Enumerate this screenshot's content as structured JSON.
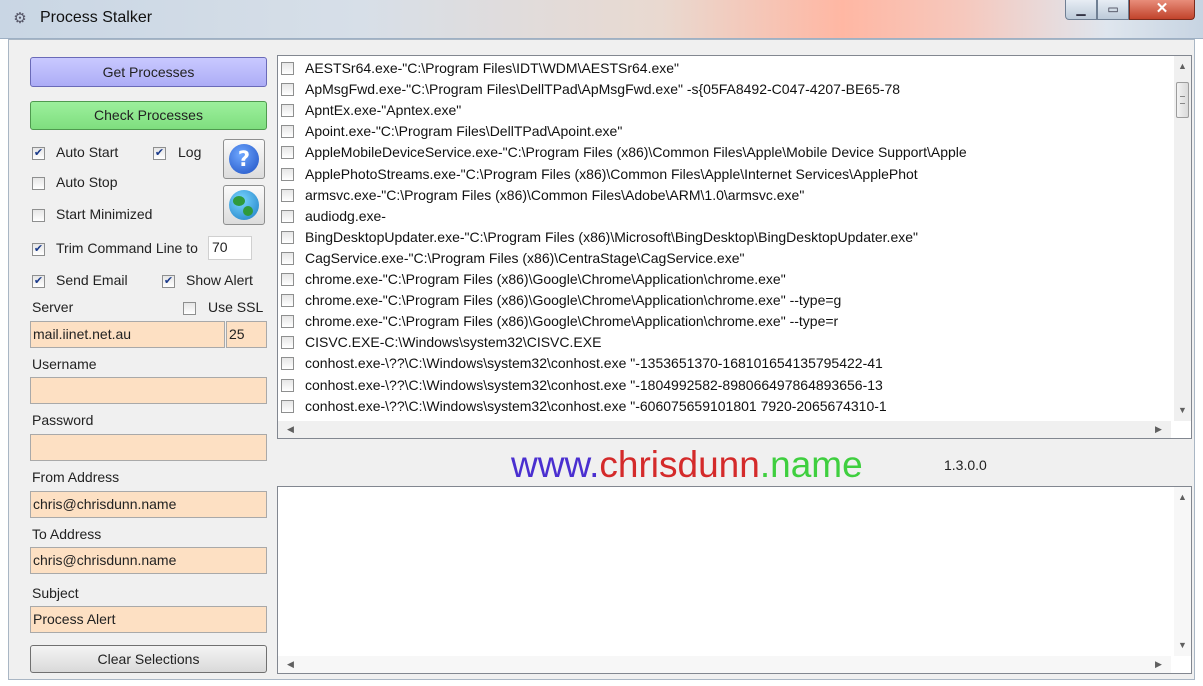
{
  "window": {
    "title": "Process Stalker",
    "app_icon": "gear-icon",
    "controls": {
      "minimize": "▁",
      "maximize": "▭",
      "close": "✕"
    }
  },
  "left_panel": {
    "get_processes": "Get Processes",
    "check_processes": "Check Processes",
    "auto_start": {
      "label": "Auto Start",
      "checked": true
    },
    "log": {
      "label": "Log",
      "checked": true
    },
    "auto_stop": {
      "label": "Auto Stop",
      "checked": false
    },
    "start_minimized": {
      "label": "Start Minimized",
      "checked": false
    },
    "trim_command_line": {
      "label": "Trim Command Line to",
      "checked": true,
      "value": "70"
    },
    "send_email": {
      "label": "Send Email",
      "checked": true
    },
    "show_alert": {
      "label": "Show Alert",
      "checked": true
    },
    "server_label": "Server",
    "use_ssl": {
      "label": "Use SSL",
      "checked": false
    },
    "server_value": "mail.iinet.net.au",
    "port_value": "25",
    "username_label": "Username",
    "username_value": "",
    "password_label": "Password",
    "password_value": "",
    "from_label": "From Address",
    "from_value": "chris@chrisdunn.name",
    "to_label": "To Address",
    "to_value": "chris@chrisdunn.name",
    "subject_label": "Subject",
    "subject_value": "Process Alert",
    "clear_selections": "Clear Selections",
    "help_icon": "help-icon",
    "web_icon": "globe-icon"
  },
  "process_list": {
    "items": [
      "AESTSr64.exe-\"C:\\Program Files\\IDT\\WDM\\AESTSr64.exe\"",
      "ApMsgFwd.exe-\"C:\\Program Files\\DellTPad\\ApMsgFwd.exe\" -s{05FA8492-C047-4207-BE65-78",
      "ApntEx.exe-\"Apntex.exe\"",
      "Apoint.exe-\"C:\\Program Files\\DellTPad\\Apoint.exe\"",
      "AppleMobileDeviceService.exe-\"C:\\Program Files (x86)\\Common Files\\Apple\\Mobile Device Support\\Apple",
      "ApplePhotoStreams.exe-\"C:\\Program Files (x86)\\Common Files\\Apple\\Internet Services\\ApplePhot",
      "armsvc.exe-\"C:\\Program Files (x86)\\Common Files\\Adobe\\ARM\\1.0\\armsvc.exe\"",
      "audiodg.exe-",
      "BingDesktopUpdater.exe-\"C:\\Program Files (x86)\\Microsoft\\BingDesktop\\BingDesktopUpdater.exe\"",
      "CagService.exe-\"C:\\Program Files (x86)\\CentraStage\\CagService.exe\"",
      "chrome.exe-\"C:\\Program Files (x86)\\Google\\Chrome\\Application\\chrome.exe\"",
      "chrome.exe-\"C:\\Program Files (x86)\\Google\\Chrome\\Application\\chrome.exe\" --type=g",
      "chrome.exe-\"C:\\Program Files (x86)\\Google\\Chrome\\Application\\chrome.exe\" --type=r",
      "CISVC.EXE-C:\\Windows\\system32\\CISVC.EXE",
      "conhost.exe-\\??\\C:\\Windows\\system32\\conhost.exe \"-1353651370-168101654135795422-41",
      "conhost.exe-\\??\\C:\\Windows\\system32\\conhost.exe \"-1804992582-898066497864893656-13",
      "conhost.exe-\\??\\C:\\Windows\\system32\\conhost.exe \"-606075659101801 7920-2065674310-1"
    ],
    "checked": [
      false,
      false,
      false,
      false,
      false,
      false,
      false,
      false,
      false,
      false,
      false,
      false,
      false,
      false,
      false,
      false,
      false
    ]
  },
  "branding": {
    "www": "www.",
    "chrisdunn": "chrisdunn",
    "dot": ".",
    "name": "name",
    "version": "1.3.0.0",
    "colors": {
      "www": "#4a2fd0",
      "chrisdunn": "#d42a2a",
      "name": "#3fcf3f"
    }
  },
  "log_output": {
    "text": ""
  }
}
